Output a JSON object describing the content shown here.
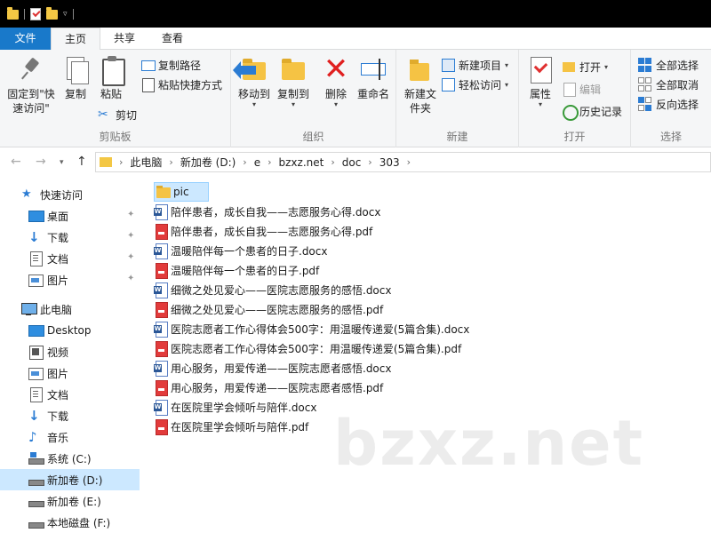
{
  "tabs": [
    {
      "label": "文件"
    },
    {
      "label": "主页"
    },
    {
      "label": "共享"
    },
    {
      "label": "查看"
    }
  ],
  "ribbon": {
    "clipboard": {
      "label": "剪贴板",
      "pin": "固定到\"快速访问\"",
      "copy": "复制",
      "paste": "粘贴",
      "copy_path": "复制路径",
      "paste_shortcut": "粘贴快捷方式",
      "cut": "剪切"
    },
    "organize": {
      "label": "组织",
      "move_to": "移动到",
      "copy_to": "复制到",
      "delete": "删除",
      "rename": "重命名"
    },
    "new": {
      "label": "新建",
      "new_folder": "新建文件夹",
      "new_item": "新建项目",
      "easy_access": "轻松访问"
    },
    "open": {
      "label": "打开",
      "properties": "属性",
      "open": "打开",
      "edit": "编辑",
      "history": "历史记录"
    },
    "select": {
      "label": "选择",
      "select_all": "全部选择",
      "select_none": "全部取消",
      "invert": "反向选择"
    }
  },
  "address": {
    "crumbs": [
      "此电脑",
      "新加卷 (D:)",
      "e",
      "bzxz.net",
      "doc",
      "303"
    ]
  },
  "sidebar": {
    "items": [
      {
        "label": "快速访问",
        "icon": "star-icon"
      },
      {
        "label": "桌面",
        "icon": "desktop-icon"
      },
      {
        "label": "下载",
        "icon": "download-icon"
      },
      {
        "label": "文档",
        "icon": "documents-icon"
      },
      {
        "label": "图片",
        "icon": "pictures-icon"
      },
      {
        "label": "此电脑",
        "icon": "computer-icon"
      },
      {
        "label": "Desktop",
        "icon": "desktop-icon"
      },
      {
        "label": "视频",
        "icon": "videos-icon"
      },
      {
        "label": "图片",
        "icon": "pictures-icon"
      },
      {
        "label": "文档",
        "icon": "documents-icon"
      },
      {
        "label": "下载",
        "icon": "download-icon"
      },
      {
        "label": "音乐",
        "icon": "music-icon"
      },
      {
        "label": "系统 (C:)",
        "icon": "drive-icon"
      },
      {
        "label": "新加卷 (D:)",
        "icon": "drive-icon"
      },
      {
        "label": "新加卷 (E:)",
        "icon": "drive-icon"
      },
      {
        "label": "本地磁盘 (F:)",
        "icon": "drive-icon"
      }
    ]
  },
  "files": [
    {
      "name": "pic",
      "type": "folder"
    },
    {
      "name": "陪伴患者，成长自我——志愿服务心得.docx",
      "type": "docx"
    },
    {
      "name": "陪伴患者，成长自我——志愿服务心得.pdf",
      "type": "pdf"
    },
    {
      "name": "温暖陪伴每一个患者的日子.docx",
      "type": "docx"
    },
    {
      "name": "温暖陪伴每一个患者的日子.pdf",
      "type": "pdf"
    },
    {
      "name": "细微之处见爱心——医院志愿服务的感悟.docx",
      "type": "docx"
    },
    {
      "name": "细微之处见爱心——医院志愿服务的感悟.pdf",
      "type": "pdf"
    },
    {
      "name": "医院志愿者工作心得体会500字：用温暖传递爱(5篇合集).docx",
      "type": "docx"
    },
    {
      "name": "医院志愿者工作心得体会500字：用温暖传递爱(5篇合集).pdf",
      "type": "pdf"
    },
    {
      "name": "用心服务，用爱传递——医院志愿者感悟.docx",
      "type": "docx"
    },
    {
      "name": "用心服务，用爱传递——医院志愿者感悟.pdf",
      "type": "pdf"
    },
    {
      "name": "在医院里学会倾听与陪伴.docx",
      "type": "docx"
    },
    {
      "name": "在医院里学会倾听与陪伴.pdf",
      "type": "pdf"
    }
  ],
  "watermark": "bzxz.net"
}
